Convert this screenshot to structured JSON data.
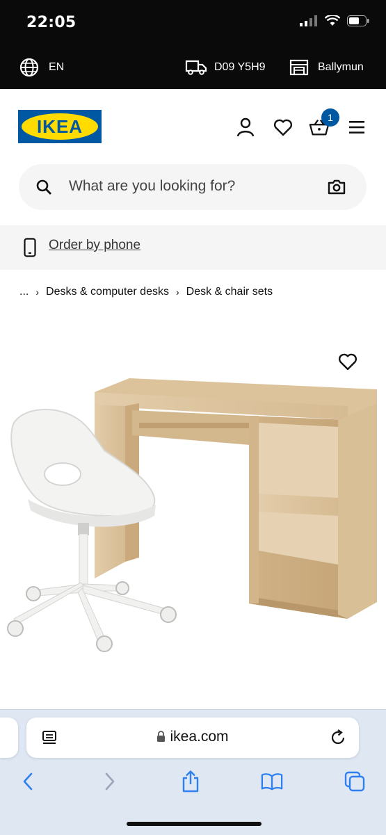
{
  "status_bar": {
    "time": "22:05"
  },
  "location_bar": {
    "language": "EN",
    "postcode": "D09 Y5H9",
    "store": "Ballymun"
  },
  "header": {
    "logo_text": "IKEA",
    "cart_count": "1"
  },
  "search": {
    "placeholder": "What are you looking for?"
  },
  "order_by_phone": {
    "label": "Order by phone"
  },
  "breadcrumb": {
    "ellipsis": "...",
    "items": [
      "Desks & computer desks",
      "Desk & chair sets"
    ]
  },
  "browser": {
    "url": "ikea.com"
  },
  "colors": {
    "ikea_blue": "#0058a3",
    "ikea_yellow": "#ffdb00",
    "status_bg": "#0a0a0a",
    "browser_bg": "#dfe7f3",
    "ios_blue": "#2f7ff0"
  },
  "icons": [
    "globe-icon",
    "truck-icon",
    "store-icon",
    "user-icon",
    "heart-icon",
    "basket-icon",
    "menu-icon",
    "search-icon",
    "camera-icon",
    "phone-icon",
    "reader-icon",
    "lock-icon",
    "reload-icon",
    "back-icon",
    "forward-icon",
    "share-icon",
    "bookmarks-icon",
    "tabs-icon"
  ]
}
